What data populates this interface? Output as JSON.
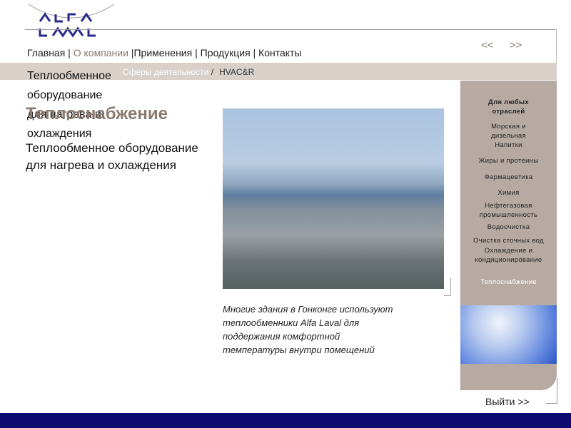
{
  "logo": {
    "text": "ALFA LAVAL"
  },
  "nav": {
    "items": [
      "Главная",
      "О компании",
      "Применения",
      "Продукция",
      "Контакты"
    ],
    "prev": "<<",
    "next": ">>"
  },
  "breadcrumb": {
    "parent": "Сферы деятельности",
    "separator": "/",
    "current": "HVAC&R"
  },
  "main": {
    "heading": "Теплоснабжение",
    "subtitle": "Теплообменное оборудование для нагрева и охлаждения",
    "caption": "Многие здания в Гонконге используют теплообменники Alfa Laval для поддержания комфортной температуры внутри помещений"
  },
  "sidebar": {
    "header": "Для любых отраслей",
    "items": [
      "Морская и дизельная",
      "Напитки",
      "Жиры и протеины",
      "Фармацевтика",
      "Химия",
      "Нефтегазовая промышленность",
      "Водоочистка",
      "Очистка сточных вод",
      "Охлаждение и кондиционирование"
    ],
    "selected": "Теплоснабжение"
  },
  "exit": "Выйти >>",
  "colors": {
    "accent": "#8b7a70",
    "sidebar": "#b7aaa3",
    "footer": "#0c0c70"
  }
}
